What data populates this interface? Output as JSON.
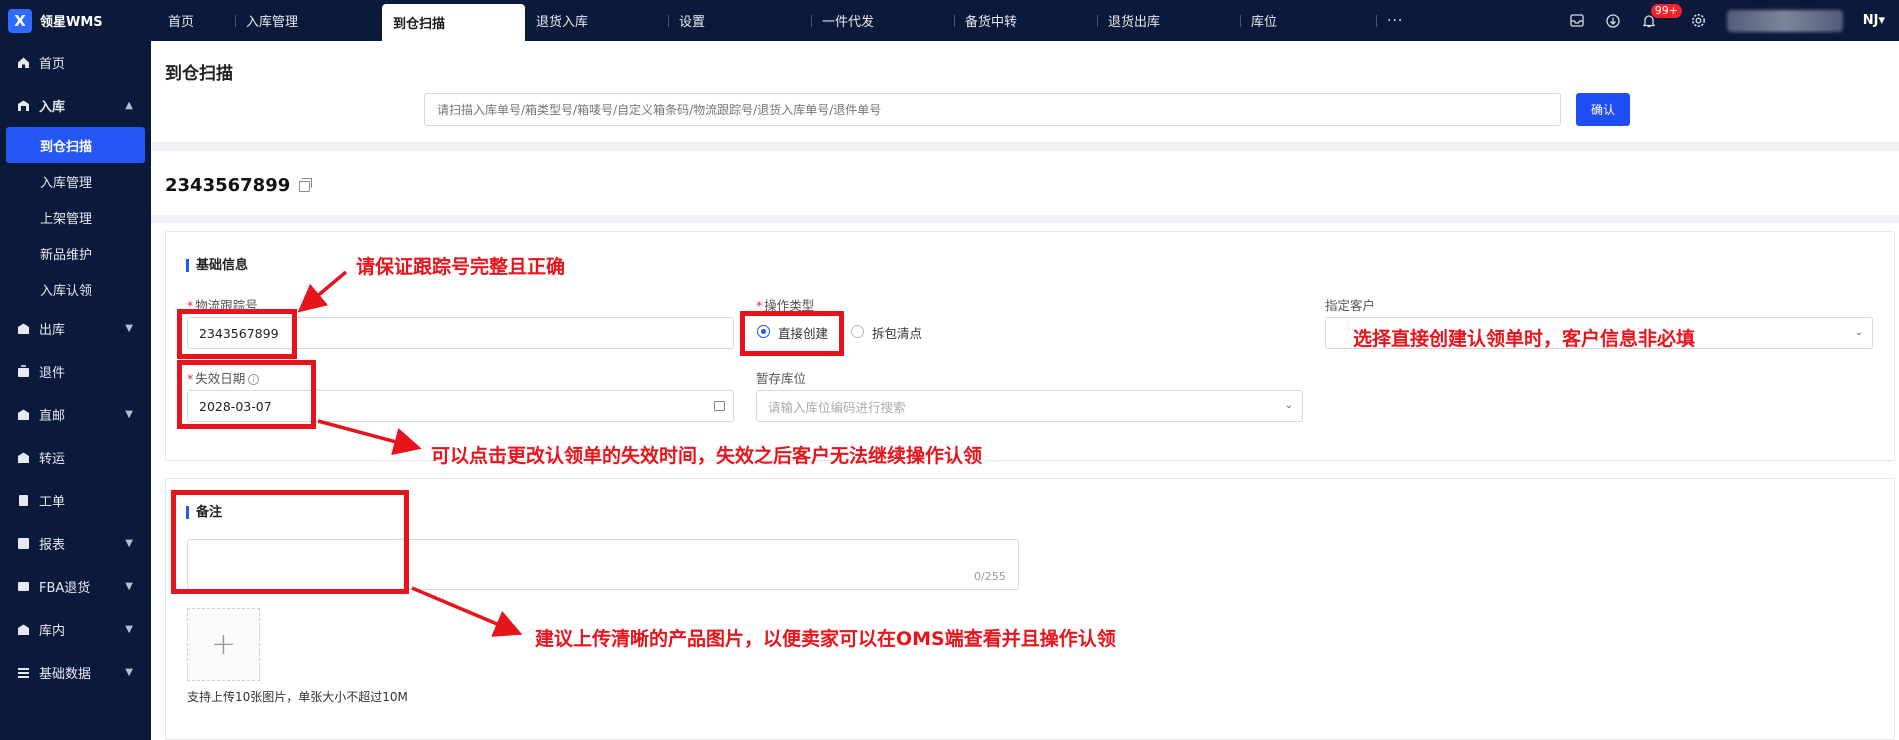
{
  "app": {
    "logo_mark": "X",
    "name": "领星WMS"
  },
  "top_nav": {
    "items": [
      {
        "label": "首页"
      },
      {
        "label": "入库管理"
      },
      {
        "label": "到仓扫描",
        "active": true
      },
      {
        "label": "退货入库"
      },
      {
        "label": "设置"
      },
      {
        "label": "一件代发"
      },
      {
        "label": "备货中转"
      },
      {
        "label": "退货出库"
      },
      {
        "label": "库位"
      }
    ],
    "more": "···",
    "notification_count": "99+",
    "org_label": "NJ▾",
    "icons": [
      "inbox-icon",
      "download-icon",
      "bell-icon",
      "settings-icon"
    ]
  },
  "sidebar": {
    "items": [
      {
        "label": "首页",
        "icon": "home-icon"
      },
      {
        "label": "入库",
        "icon": "inbound-icon",
        "expanded": true
      },
      {
        "label": "出库",
        "icon": "outbound-icon"
      },
      {
        "label": "退件",
        "icon": "return-icon"
      },
      {
        "label": "直邮",
        "icon": "direct-mail-icon"
      },
      {
        "label": "转运",
        "icon": "transfer-icon"
      },
      {
        "label": "工单",
        "icon": "work-order-icon"
      },
      {
        "label": "报表",
        "icon": "report-icon"
      },
      {
        "label": "FBA退货",
        "icon": "fba-return-icon"
      },
      {
        "label": "库内",
        "icon": "warehouse-icon"
      },
      {
        "label": "基础数据",
        "icon": "base-data-icon"
      }
    ],
    "inbound_sub": [
      {
        "label": "到仓扫描",
        "active": true
      },
      {
        "label": "入库管理"
      },
      {
        "label": "上架管理"
      },
      {
        "label": "新品维护"
      },
      {
        "label": "入库认领"
      }
    ]
  },
  "page": {
    "title": "到仓扫描",
    "scan_placeholder": "请扫描入库单号/箱类型号/箱唛号/自定义箱条码/物流跟踪号/退货入库单号/退件单号",
    "confirm_label": "确认",
    "order_number": "2343567899"
  },
  "basic_info": {
    "title": "基础信息",
    "tracking_label": "物流跟踪号",
    "tracking_value": "2343567899",
    "op_type_label": "操作类型",
    "op_options": [
      "直接创建",
      "拆包清点"
    ],
    "customer_label": "指定客户",
    "expiry_label": "失效日期",
    "expiry_value": "2028-03-07",
    "temp_location_label": "暂存库位",
    "temp_location_placeholder": "请输入库位编码进行搜索"
  },
  "remarks": {
    "title": "备注",
    "counter": "0/255",
    "upload_hint": "支持上传10张图片，单张大小不超过10M"
  },
  "annotations": {
    "tracking_note": "请保证跟踪号完整且正确",
    "customer_note": "选择直接创建认领单时，客户信息非必填",
    "expiry_note": "可以点击更改认领单的失效时间，失效之后客户无法继续操作认领",
    "upload_note": "建议上传清晰的产品图片，以便卖家可以在OMS端查看并且操作认领",
    "color": "#e8141c"
  },
  "colors": {
    "nav_bg": "#0b1a3a",
    "accent": "#2457f5",
    "button": "#1f4ef5"
  }
}
